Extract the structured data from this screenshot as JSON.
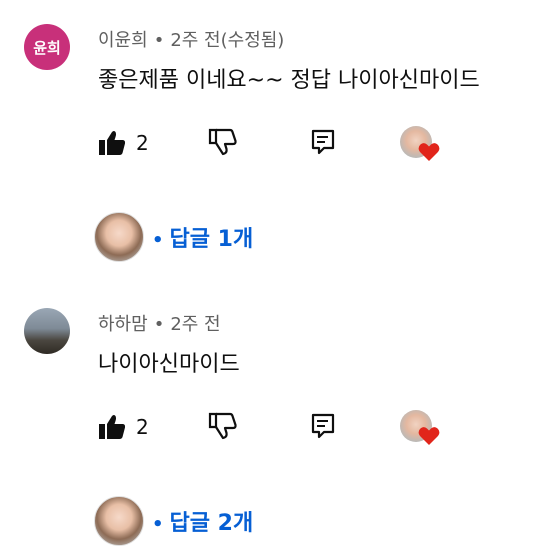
{
  "comments": [
    {
      "avatar_text": "윤희",
      "author": "이윤희",
      "separator": "•",
      "time": "2주 전(수정됨)",
      "text": "좋은제품 이네요~~ 정답 나이아신마이드",
      "likes": "2",
      "replies_separator": "•",
      "replies_label": "답글 1개"
    },
    {
      "author": "하하맘",
      "separator": "•",
      "time": "2주 전",
      "text": "나이아신마이드",
      "likes": "2",
      "replies_separator": "•",
      "replies_label": "답글 2개"
    }
  ],
  "colors": {
    "accent_link": "#065fd4",
    "heart": "#e1251b",
    "avatar_bg": "#c8307a"
  },
  "icons": [
    "thumbs-up-icon",
    "thumbs-down-icon",
    "reply-icon",
    "heart-icon"
  ]
}
